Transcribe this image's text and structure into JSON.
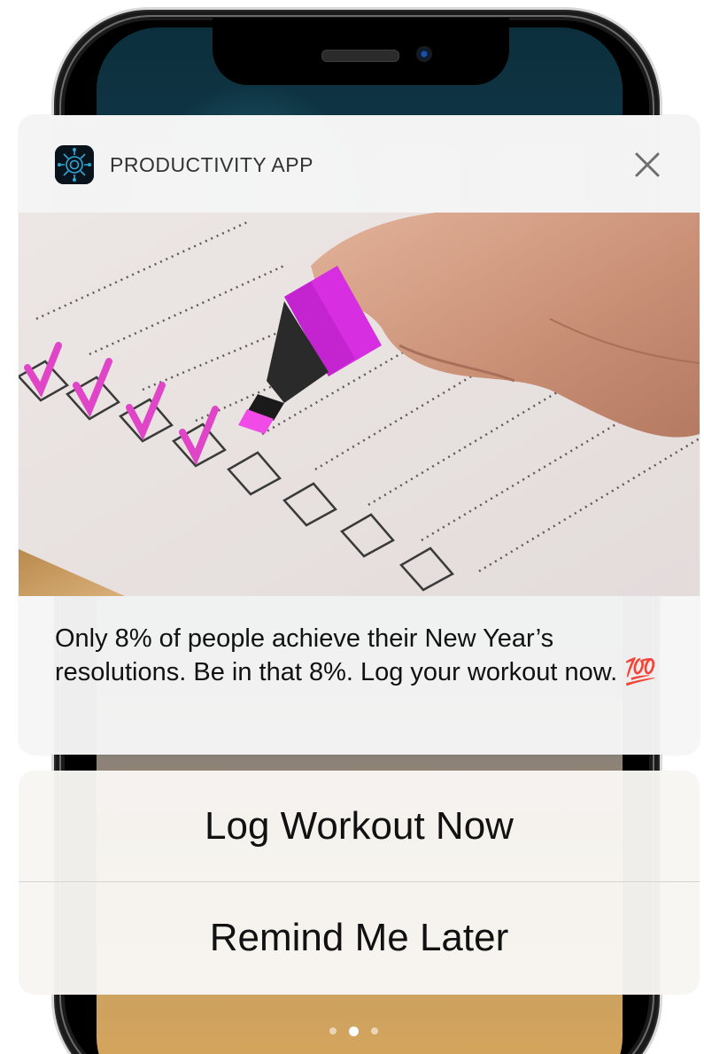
{
  "notification": {
    "app_name": "PRODUCTIVITY APP",
    "app_icon": "productivity-app-icon",
    "close_icon": "close-icon",
    "image": "checklist-highlighter-photo",
    "message": "Only 8% of people achieve their New Year’s resolutions. Be in that 8%. Log your workout now. 💯"
  },
  "actions": {
    "primary_label": "Log Workout Now",
    "secondary_label": "Remind Me Later"
  },
  "home": {
    "page_count": 3,
    "active_page": 2
  }
}
